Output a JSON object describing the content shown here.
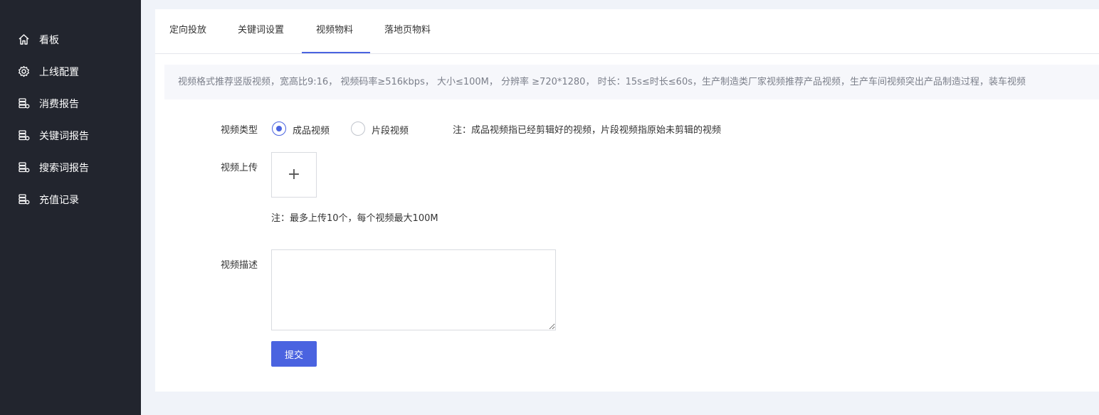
{
  "sidebar": {
    "items": [
      {
        "label": "看板",
        "icon": "home-icon"
      },
      {
        "label": "上线配置",
        "icon": "gear-icon"
      },
      {
        "label": "消费报告",
        "icon": "database-icon"
      },
      {
        "label": "关键词报告",
        "icon": "database-icon"
      },
      {
        "label": "搜索词报告",
        "icon": "database-icon"
      },
      {
        "label": "充值记录",
        "icon": "database-icon"
      }
    ]
  },
  "tabs": [
    {
      "label": "定向投放"
    },
    {
      "label": "关键词设置"
    },
    {
      "label": "视频物料",
      "active": true
    },
    {
      "label": "落地页物料"
    }
  ],
  "notice": "视频格式推荐竖版视频，宽高比9:16， 视频码率≥516kbps， 大小≤100M， 分辨率 ≥720*1280， 时长：15s≤时长≤60s，生产制造类厂家视频推荐产品视频，生产车间视频突出产品制造过程，装车视频",
  "form": {
    "video_type": {
      "label": "视频类型",
      "options": [
        {
          "label": "成品视频",
          "checked": true
        },
        {
          "label": "片段视频",
          "checked": false
        }
      ],
      "note": "注：成品视频指已经剪辑好的视频，片段视频指原始未剪辑的视频"
    },
    "upload": {
      "label": "视频上传",
      "plus": "+",
      "note": "注：最多上传10个，每个视频最大100M"
    },
    "description": {
      "label": "视频描述",
      "value": ""
    },
    "submit_label": "提交"
  },
  "colors": {
    "sidebar_bg": "#22252e",
    "accent": "#4a63e0",
    "page_bg": "#f0f3f9"
  }
}
